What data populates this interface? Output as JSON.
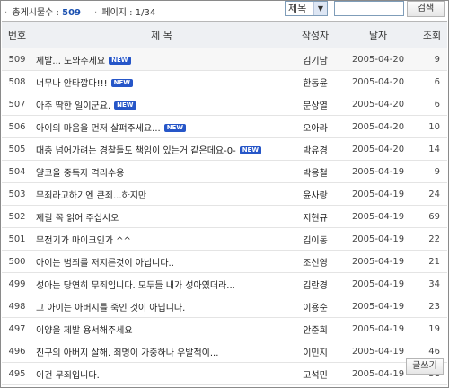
{
  "stats": {
    "total_label": "총게시물수 :",
    "total_value": "509",
    "page_label": "페이지 :",
    "page_value": "1/34"
  },
  "search": {
    "field_selected": "제목",
    "input_value": "",
    "button_label": "검색"
  },
  "table": {
    "headers": [
      "번호",
      "제 목",
      "작성자",
      "날자",
      "조회"
    ],
    "rows": [
      {
        "no": "509",
        "title": "제발... 도와주세요",
        "new": true,
        "author": "김기남",
        "date": "2005-04-20",
        "hits": "9"
      },
      {
        "no": "508",
        "title": "너무나 안타깝다!!!",
        "new": true,
        "author": "한동윤",
        "date": "2005-04-20",
        "hits": "6"
      },
      {
        "no": "507",
        "title": "아주 딱한 일이군요.",
        "new": true,
        "author": "문상열",
        "date": "2005-04-20",
        "hits": "6"
      },
      {
        "no": "506",
        "title": "아이의 마음을 먼저 살펴주세요...",
        "new": true,
        "author": "오아라",
        "date": "2005-04-20",
        "hits": "10"
      },
      {
        "no": "505",
        "title": "대충 넘어가려는 경찰들도 책임이 있는거 같은데요-0-",
        "new": true,
        "author": "박유경",
        "date": "2005-04-20",
        "hits": "14"
      },
      {
        "no": "504",
        "title": "얄코올 중독자 격리수용",
        "new": false,
        "author": "박용철",
        "date": "2005-04-19",
        "hits": "9"
      },
      {
        "no": "503",
        "title": "무죄라고하기엔 큰죄...하지만",
        "new": false,
        "author": "윤사랑",
        "date": "2005-04-19",
        "hits": "24"
      },
      {
        "no": "502",
        "title": "제길 꼭 읽어 주십시오",
        "new": false,
        "author": "지현규",
        "date": "2005-04-19",
        "hits": "69"
      },
      {
        "no": "501",
        "title": "무전기가 마이크인가 ^^",
        "new": false,
        "author": "김이동",
        "date": "2005-04-19",
        "hits": "22"
      },
      {
        "no": "500",
        "title": "아이는 범죄를 저지른것이 아닙니다..",
        "new": false,
        "author": "조신영",
        "date": "2005-04-19",
        "hits": "21"
      },
      {
        "no": "499",
        "title": "성아는 당연히 무죄입니다. 모두들 내가 성아였더라...",
        "new": false,
        "author": "김란경",
        "date": "2005-04-19",
        "hits": "34"
      },
      {
        "no": "498",
        "title": "그 아이는 아버지를 죽인 것이 아닙니다.",
        "new": false,
        "author": "이용순",
        "date": "2005-04-19",
        "hits": "23"
      },
      {
        "no": "497",
        "title": "이양을 제발 용서해주세요",
        "new": false,
        "author": "안준희",
        "date": "2005-04-19",
        "hits": "19"
      },
      {
        "no": "496",
        "title": "친구의 아버지 살해. 죄명이 가중하나 우발적이...",
        "new": false,
        "author": "이민지",
        "date": "2005-04-19",
        "hits": "46"
      },
      {
        "no": "495",
        "title": "이건 무죄입니다.",
        "new": false,
        "author": "고석민",
        "date": "2005-04-19",
        "hits": "31"
      }
    ]
  },
  "new_badge": "NEW",
  "write_button_label": "글쓰기"
}
